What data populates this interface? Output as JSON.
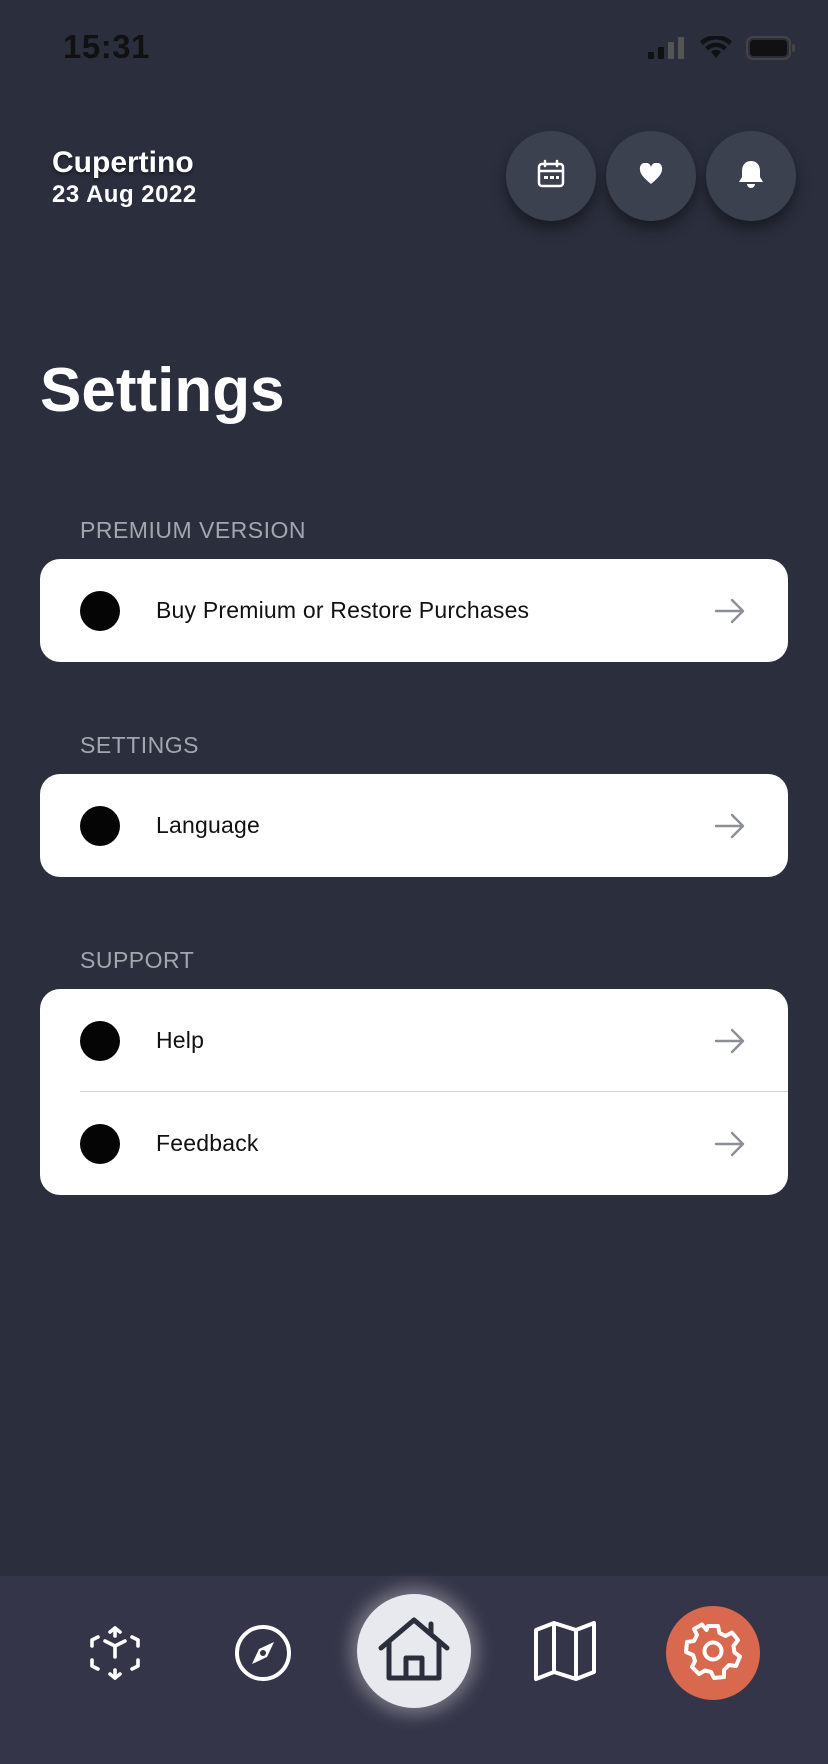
{
  "status_bar": {
    "time": "15:31",
    "icons": [
      "signal-icon",
      "wifi-icon",
      "battery-icon"
    ]
  },
  "header": {
    "location": "Cupertino",
    "date": "23 Aug 2022",
    "buttons": [
      "calendar-icon",
      "heart-icon",
      "bell-icon"
    ]
  },
  "page": {
    "title": "Settings"
  },
  "sections": [
    {
      "label": "PREMIUM VERSION",
      "items": [
        {
          "label": "Buy Premium or Restore Purchases"
        }
      ]
    },
    {
      "label": "SETTINGS",
      "items": [
        {
          "label": "Language"
        }
      ]
    },
    {
      "label": "SUPPORT",
      "items": [
        {
          "label": "Help"
        },
        {
          "label": "Feedback"
        }
      ]
    }
  ],
  "tab_bar": {
    "items": [
      "ar-cube-icon",
      "compass-icon",
      "home-icon",
      "map-icon",
      "gear-icon"
    ],
    "active": "gear-icon",
    "active_color": "#d8694f"
  },
  "colors": {
    "background": "#2b2f3d",
    "card": "#ffffff",
    "tab_bar": "#343548",
    "section_label": "#a3a6ae"
  }
}
